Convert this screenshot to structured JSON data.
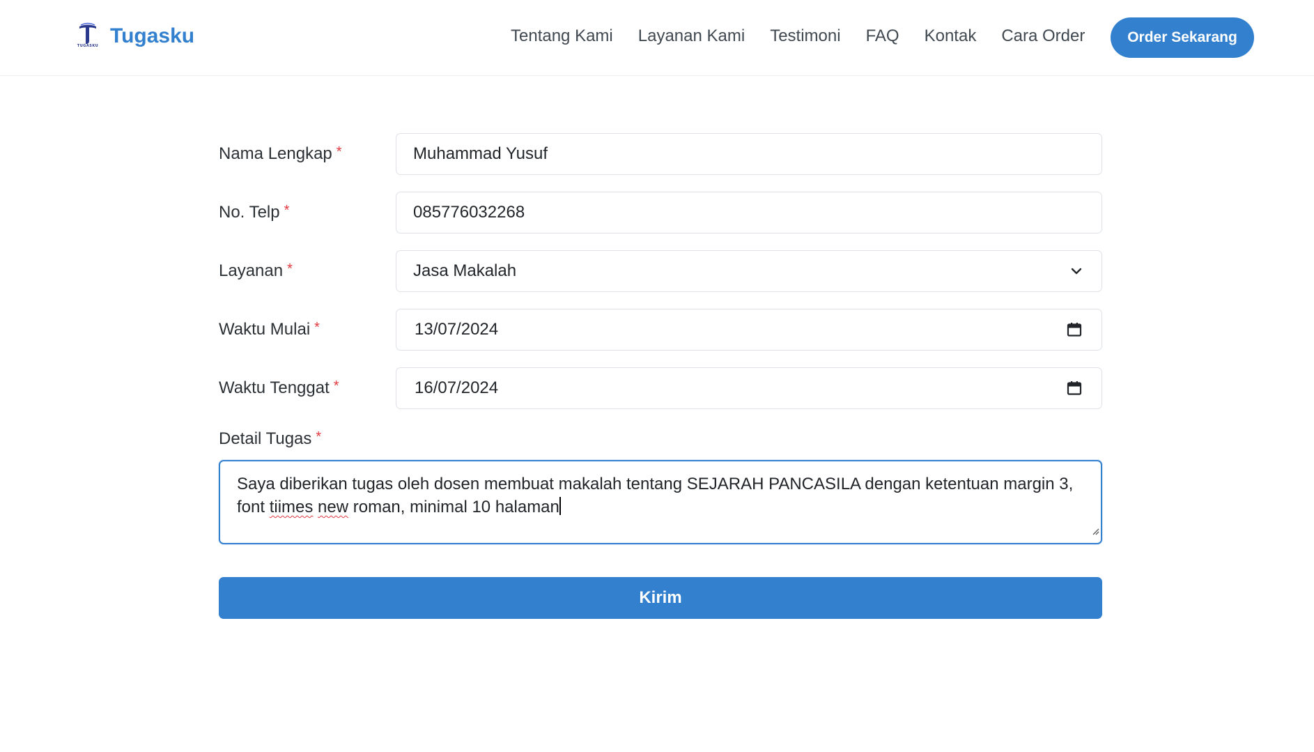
{
  "brand": {
    "name": "Tugasku",
    "logo_letter": "T",
    "logo_caption": "TUGASKU",
    "color": "#3380cf"
  },
  "nav": {
    "items": [
      {
        "label": "Tentang Kami"
      },
      {
        "label": "Layanan Kami"
      },
      {
        "label": "Testimoni"
      },
      {
        "label": "FAQ"
      },
      {
        "label": "Kontak"
      },
      {
        "label": "Cara Order"
      }
    ],
    "cta_label": "Order Sekarang"
  },
  "form": {
    "required_marker": "*",
    "nama": {
      "label": "Nama Lengkap",
      "value": "Muhammad Yusuf"
    },
    "telp": {
      "label": "No. Telp",
      "value": "085776032268"
    },
    "layanan": {
      "label": "Layanan",
      "value": "Jasa Makalah",
      "icon": "chevron-down-icon"
    },
    "mulai": {
      "label": "Waktu Mulai",
      "value": "13/07/2024",
      "icon": "calendar-icon"
    },
    "tenggat": {
      "label": "Waktu Tenggat",
      "value": "16/07/2024",
      "icon": "calendar-icon"
    },
    "detail": {
      "label": "Detail Tugas",
      "text_part1": "Saya diberikan tugas oleh dosen membuat makalah tentang SEJARAH PANCASILA dengan ketentuan margin 3, font ",
      "misspelled1": "tiimes",
      "text_part2": " ",
      "misspelled2": "new",
      "text_part3": " roman, minimal 10 halaman"
    },
    "submit_label": "Kirim"
  },
  "colors": {
    "accent": "#3380cf",
    "required": "#e0383e",
    "border": "#dee2e6"
  }
}
